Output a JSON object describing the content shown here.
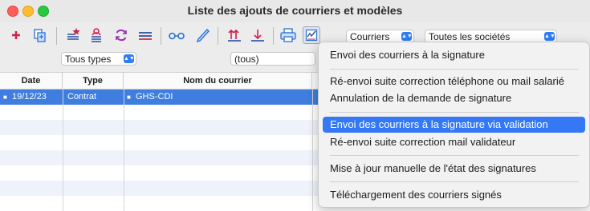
{
  "window": {
    "title": "Liste des ajouts de courriers et modèles"
  },
  "filters": {
    "types": "Tous types",
    "tous": "(tous)",
    "courriers": "Courriers",
    "societes": "Toutes les sociétés"
  },
  "table": {
    "columns": [
      "Date",
      "Type",
      "Nom du courrier"
    ],
    "rows": [
      {
        "date": "19/12/23",
        "type": "Contrat",
        "nom": "GHS-CDI"
      }
    ]
  },
  "menu": {
    "items": [
      "Envoi des courriers à la signature",
      "Ré-envoi suite correction téléphone ou mail salarié",
      "Annulation de la demande de signature",
      "Envoi des courriers à la signature via validation",
      "Ré-envoi suite correction mail validateur",
      "Mise à jour manuelle de l'état des signatures",
      "Téléchargement des courriers signés"
    ]
  },
  "colors": {
    "selection": "#3f7ede",
    "menu_highlight": "#3478f6",
    "accent": "#2f7cf6"
  }
}
